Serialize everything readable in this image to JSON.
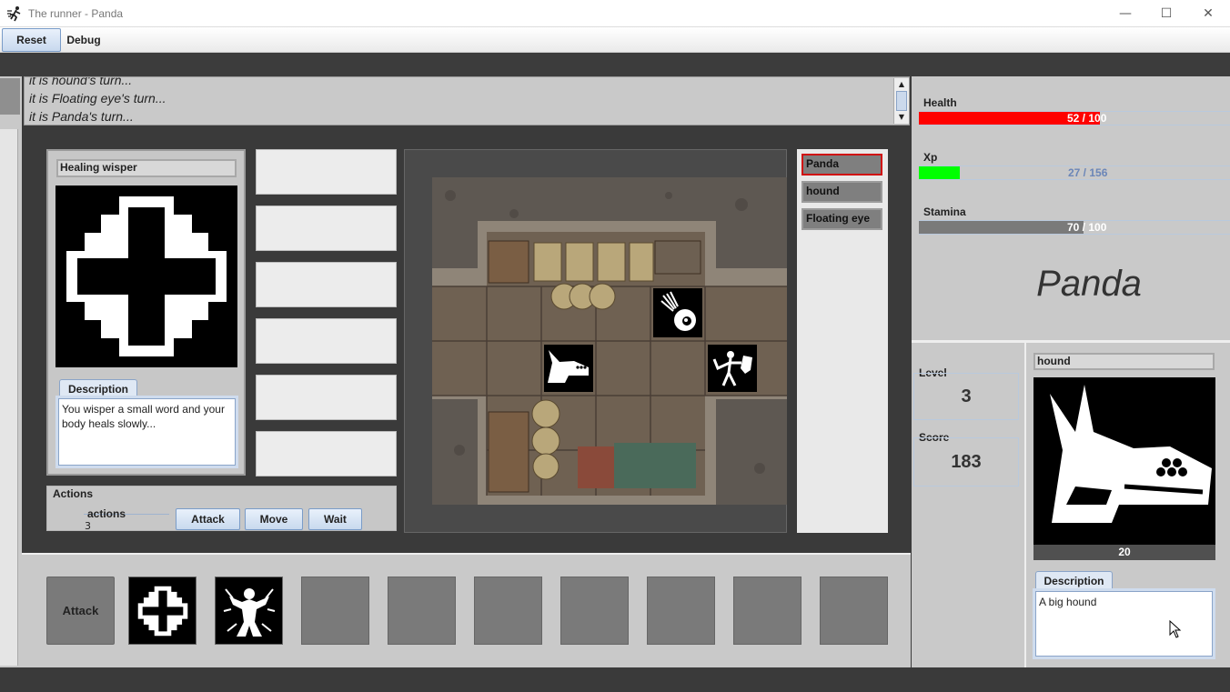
{
  "window": {
    "title": "The runner - Panda",
    "minimize": "—",
    "maximize": "☐",
    "close": "✕"
  },
  "menu": {
    "reset": "Reset",
    "debug": "Debug"
  },
  "log": {
    "lines": [
      "it is hound's turn...",
      "it is Floating eye's turn...",
      "it is Panda's turn..."
    ]
  },
  "skill": {
    "name": "Healing wisper",
    "icon": "healing-cross-icon",
    "description_tab": "Description",
    "description": "You wisper a small word and your body heals slowly..."
  },
  "actions": {
    "title": "Actions",
    "count_label": "actions",
    "count_value": "3",
    "buttons": [
      "Attack",
      "Move",
      "Wait"
    ]
  },
  "turn_order": [
    "Panda",
    "hound",
    "Floating eye"
  ],
  "hotbar": {
    "first": "Attack",
    "icons": [
      "healing-cross-icon",
      "burst-figure-icon"
    ]
  },
  "player": {
    "name": "Panda",
    "health": {
      "label": "Health",
      "text": "52 / 100",
      "value": 52,
      "max": 100,
      "color": "#ff0000"
    },
    "xp": {
      "label": "Xp",
      "text": "27 / 156",
      "value": 27,
      "max": 156,
      "color": "#00ff00"
    },
    "stamina": {
      "label": "Stamina",
      "text": "70 / 100",
      "value": 70,
      "max": 100,
      "color": "#7a7a7a"
    },
    "level_label": "Level",
    "level": "3",
    "score_label": "Score",
    "score": "183"
  },
  "target": {
    "name": "hound",
    "icon": "hound-head-icon",
    "value": "20",
    "description_tab": "Description",
    "description": "A big hound"
  }
}
